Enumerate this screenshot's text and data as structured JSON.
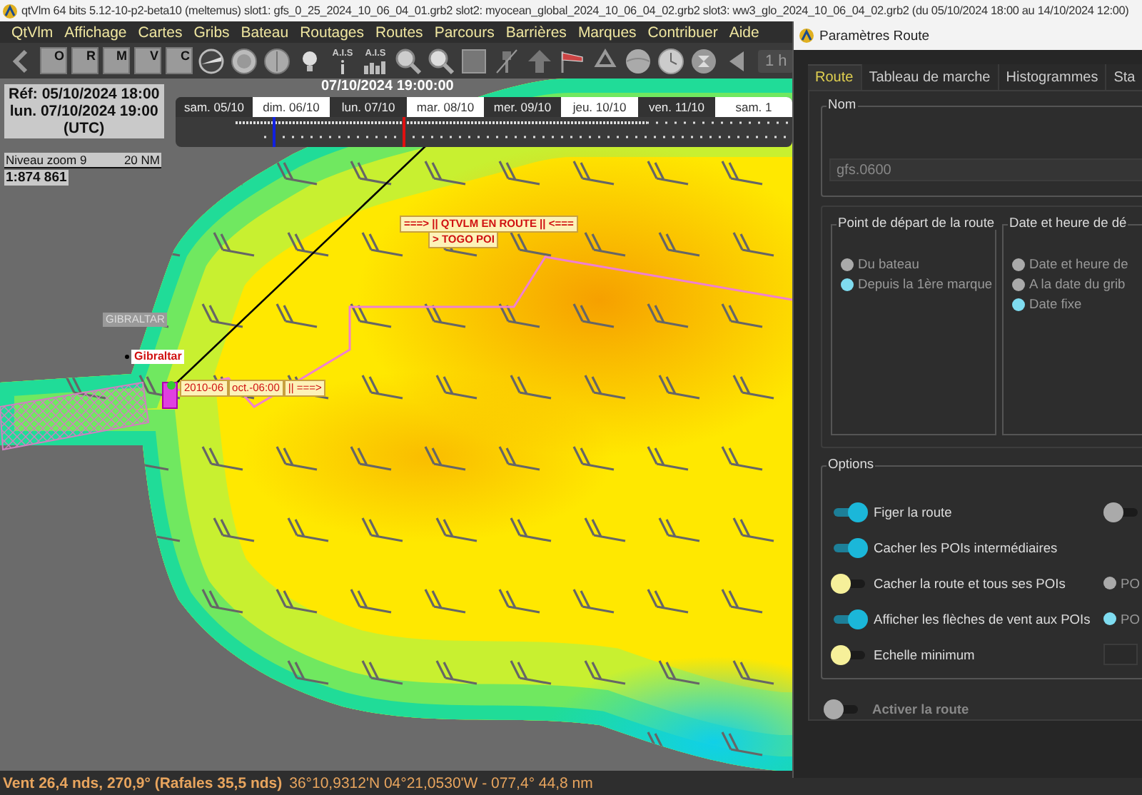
{
  "window": {
    "title": "qtVlm 64 bits 5.12-10-p2-beta10 (meltemus) slot1: gfs_0_25_2024_10_06_04_01.grb2 slot2: myocean_global_2024_10_06_04_02.grb2 slot3: ww3_glo_2024_10_06_04_02.grb2 (du 05/10/2024 18:00 au 14/10/2024 12:00)"
  },
  "menu": [
    "QtVlm",
    "Affichage",
    "Cartes",
    "Gribs",
    "Bateau",
    "Routages",
    "Routes",
    "Parcours",
    "Barrières",
    "Marques",
    "Contribuer",
    "Aide"
  ],
  "toolbar": {
    "map_buttons": [
      "O",
      "R",
      "M",
      "V",
      "C"
    ],
    "ais_labels": [
      "A.I.S",
      "A.I.S"
    ],
    "step": "1 h"
  },
  "map": {
    "reference": "Réf: 05/10/2024 18:00",
    "current": "lun. 07/10/2024 19:00",
    "timezone": "(UTC)",
    "scale": {
      "zoom": "Niveau zoom 9",
      "distance": "20 NM",
      "ratio": "1:874 861"
    },
    "timeline": {
      "title": "07/10/2024 19:00:00",
      "days": [
        "sam. 05/10",
        "dim. 06/10",
        "lun. 07/10",
        "mar. 08/10",
        "mer. 09/10",
        "jeu. 10/10",
        "ven. 11/10",
        "sam. 1"
      ]
    },
    "labels": [
      {
        "kind": "route",
        "text": "===> ||  QTVLM EN ROUTE || <==="
      },
      {
        "kind": "poi",
        "text": "> TOGO POI"
      },
      {
        "kind": "place",
        "text": "GIBRALTAR"
      },
      {
        "kind": "city",
        "text": "Gibraltar"
      }
    ],
    "boat_label": [
      "2010-06",
      "oct.-06:00",
      "|| ===>"
    ]
  },
  "status_bar": {
    "wind": "Vent 26,4 nds, 270,9° (Rafales 35,5 nds)",
    "position": "36°10,9312'N 04°21,0530'W - 077,4° 44,8 nm"
  },
  "dialog": {
    "title": "Paramètres Route",
    "tabs": [
      {
        "label": "Route",
        "selected": true
      },
      {
        "label": "Tableau de marche",
        "selected": false
      },
      {
        "label": "Histogrammes",
        "selected": false
      },
      {
        "label": "Sta",
        "selected": false
      }
    ],
    "name_group": {
      "title": "Nom",
      "value": "gfs.0600"
    },
    "start_group": {
      "title": "Point de départ de la route",
      "options": [
        {
          "label": "Du bateau",
          "selected": false
        },
        {
          "label": "Depuis la 1ère marque",
          "selected": true
        }
      ]
    },
    "date_group": {
      "title": "Date et heure de dé",
      "options": [
        {
          "label": "Date et heure de",
          "selected": false
        },
        {
          "label": "A la date du grib",
          "selected": false
        },
        {
          "label": "Date fixe",
          "selected": true
        }
      ]
    },
    "options_group": {
      "title": "Options",
      "toggles": [
        {
          "label": "Figer la route",
          "on": true,
          "side": {
            "kind": "toggle",
            "on": false
          }
        },
        {
          "label": "Cacher les POIs intermédiaires",
          "on": true
        },
        {
          "label": "Cacher la route et tous ses POIs",
          "on": false,
          "side": {
            "kind": "radio",
            "label": "PO",
            "selected": false
          }
        },
        {
          "label": "Afficher les flèches de vent aux POIs",
          "on": true,
          "side": {
            "kind": "radio",
            "label": "PO",
            "selected": true
          }
        },
        {
          "label": "Echelle minimum",
          "on": false,
          "side": {
            "kind": "field"
          }
        }
      ]
    },
    "activate": {
      "label": "Activer la route",
      "on": false,
      "disabled": true
    }
  }
}
